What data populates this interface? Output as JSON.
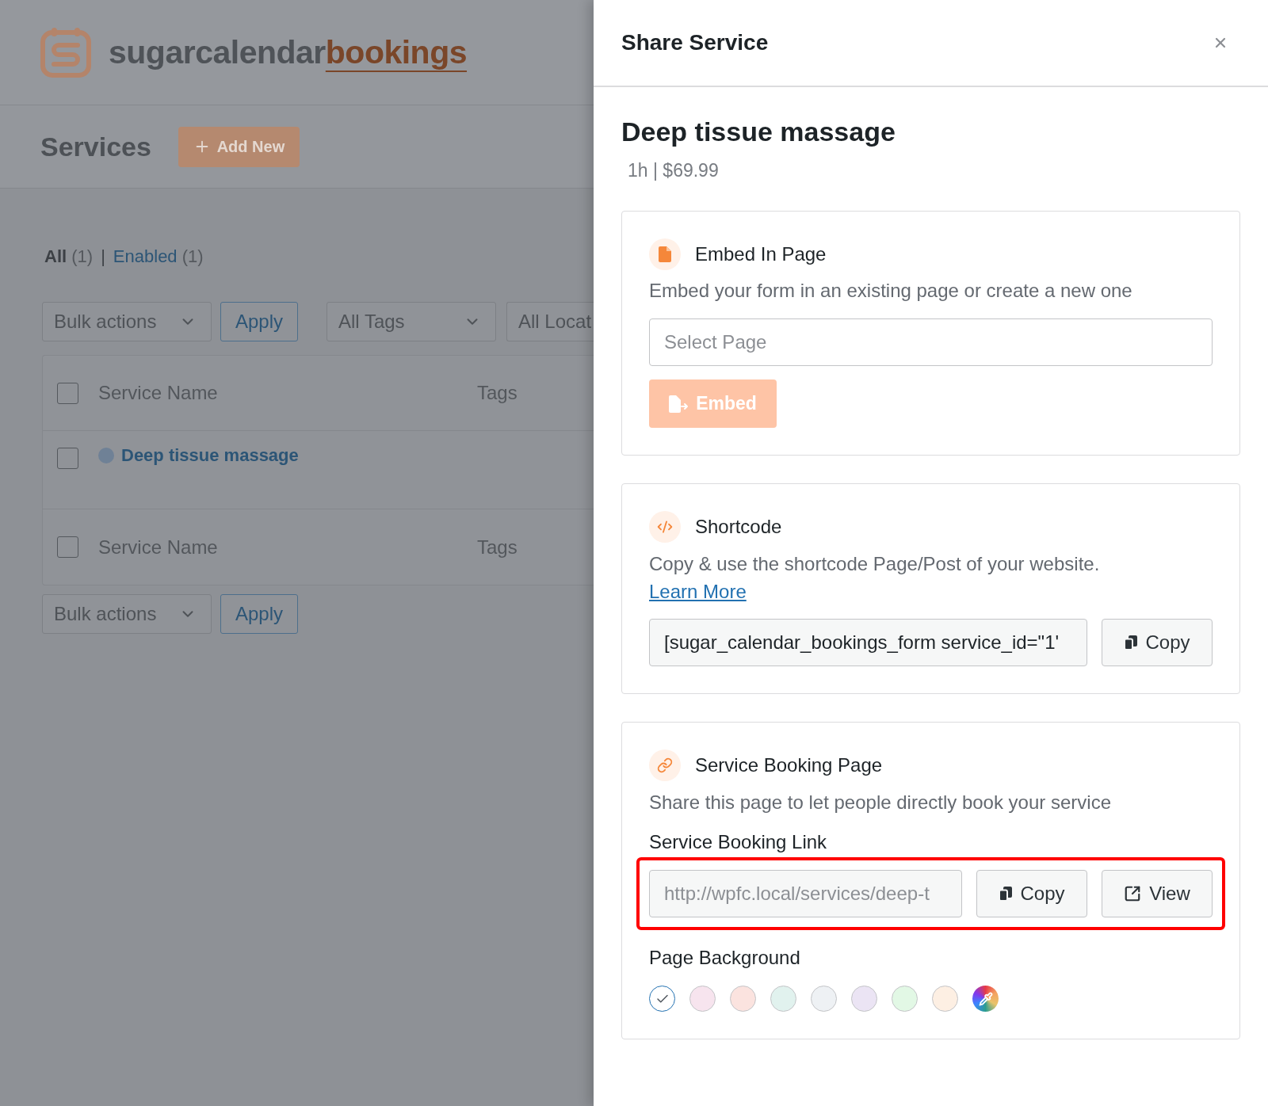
{
  "background_page": {
    "logo": {
      "name": "sugarcalendar",
      "accent": "bookings"
    },
    "title": "Services",
    "add_button": "Add New",
    "filters": [
      {
        "label": "All",
        "count": "(1)",
        "selected": true
      },
      {
        "label": "Enabled",
        "count": "(1)",
        "selected": false
      }
    ],
    "filter_separator": "|",
    "top_actions": {
      "bulk_select": "Bulk actions",
      "apply": "Apply",
      "tags_select": "All Tags",
      "locations_select": "All Locat"
    },
    "table": {
      "header": {
        "checked": false,
        "columns": [
          "Service Name",
          "Tags"
        ]
      },
      "rows": [
        {
          "checked": false,
          "name": "Deep tissue massage",
          "color": "#6f8196"
        }
      ],
      "footer": {
        "checked": false,
        "columns": [
          "Service Name",
          "Tags"
        ]
      }
    },
    "bottom_actions": {
      "bulk_select": "Bulk actions",
      "apply": "Apply"
    }
  },
  "drawer": {
    "title": "Share Service",
    "service": {
      "name": "Deep tissue massage",
      "meta": "1h | $69.99"
    },
    "sections": [
      {
        "kind": "embed",
        "title": "Embed In Page",
        "description": "Embed your form in an existing page or create a new one",
        "select": {
          "placeholder": "Select Page"
        },
        "button": {
          "label": "Embed",
          "disabled": true
        }
      },
      {
        "kind": "shortcode",
        "title": "Shortcode",
        "description": "Copy & use the shortcode Page/Post of your website.",
        "link": "Learn More",
        "field": {
          "value": "[sugar_calendar_bookings_form service_id=\"1'"
        },
        "copy_button": "Copy"
      },
      {
        "kind": "booking",
        "title": "Service Booking Page",
        "description": "Share this page to let people directly book your service",
        "link_label": "Service Booking Link",
        "field": {
          "value": "http://wpfc.local/services/deep-t"
        },
        "copy_button": "Copy",
        "view_button": "View",
        "highlighted": true,
        "background_label": "Page Background",
        "swatches": [
          {
            "kind": "color",
            "color": "#ffffff",
            "selected": true
          },
          {
            "kind": "color",
            "color": "#f7e4ee",
            "selected": false
          },
          {
            "kind": "color",
            "color": "#fbe3df",
            "selected": false
          },
          {
            "kind": "color",
            "color": "#e1f2ee",
            "selected": false
          },
          {
            "kind": "color",
            "color": "#eef1f4",
            "selected": false
          },
          {
            "kind": "color",
            "color": "#ebe4f4",
            "selected": false
          },
          {
            "kind": "color",
            "color": "#e2f8e5",
            "selected": false
          },
          {
            "kind": "color",
            "color": "#fdefe3",
            "selected": false
          },
          {
            "kind": "picker",
            "selected": false
          }
        ]
      }
    ]
  }
}
